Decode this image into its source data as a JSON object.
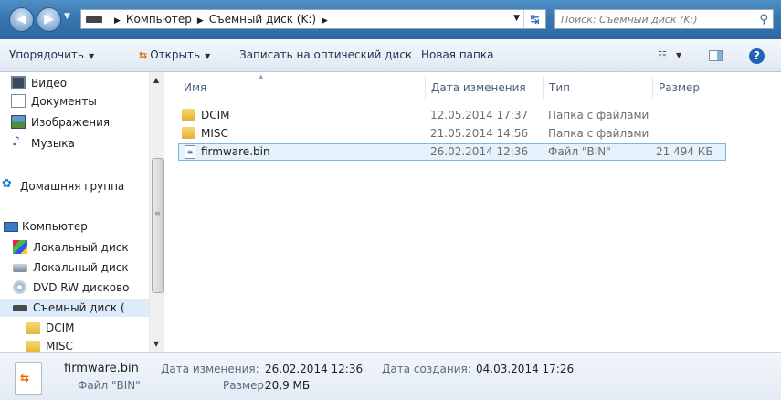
{
  "address_bar": {
    "back_icon": "back-arrow-icon",
    "forward_icon": "forward-arrow-icon",
    "breadcrumbs": [
      "Компьютер",
      "Съемный диск (K:)"
    ],
    "search_placeholder": "Поиск: Съемный диск (K:)"
  },
  "toolbar": {
    "organize": "Упорядочить",
    "open": "Открыть",
    "burn": "Записать на оптический диск",
    "new_folder": "Новая папка"
  },
  "nav": {
    "items": [
      {
        "label": "Видео",
        "icon": "video-library-icon"
      },
      {
        "label": "Документы",
        "icon": "documents-library-icon"
      },
      {
        "label": "Изображения",
        "icon": "pictures-library-icon"
      },
      {
        "label": "Музыка",
        "icon": "music-library-icon"
      },
      {
        "label": "Домашняя группа",
        "icon": "homegroup-icon"
      },
      {
        "label": "Компьютер",
        "icon": "computer-icon"
      },
      {
        "label": "Локальный диск",
        "icon": "windows-drive-icon"
      },
      {
        "label": "Локальный диск",
        "icon": "local-drive-icon"
      },
      {
        "label": "DVD RW дисково",
        "icon": "dvd-drive-icon"
      },
      {
        "label": "Съемный диск (",
        "icon": "removable-drive-icon"
      },
      {
        "label": "DCIM",
        "icon": "folder-icon"
      },
      {
        "label": "MISC",
        "icon": "folder-icon"
      }
    ]
  },
  "columns": {
    "name": "Имя",
    "date": "Дата изменения",
    "type": "Тип",
    "size": "Размер"
  },
  "files": [
    {
      "name": "DCIM",
      "date": "12.05.2014 17:37",
      "type": "Папка с файлами",
      "size": "",
      "icon": "folder-icon"
    },
    {
      "name": "MISC",
      "date": "21.05.2014 14:56",
      "type": "Папка с файлами",
      "size": "",
      "icon": "folder-icon"
    },
    {
      "name": "firmware.bin",
      "date": "26.02.2014 12:36",
      "type": "Файл \"BIN\"",
      "size": "21 494 КБ",
      "icon": "bin-file-icon"
    }
  ],
  "details": {
    "filename": "firmware.bin",
    "filetype": "Файл \"BIN\"",
    "modified_label": "Дата изменения:",
    "modified_value": "26.02.2014 12:36",
    "size_label": "Размер:",
    "size_value": "20,9 МБ",
    "created_label": "Дата создания:",
    "created_value": "04.03.2014 17:26"
  }
}
